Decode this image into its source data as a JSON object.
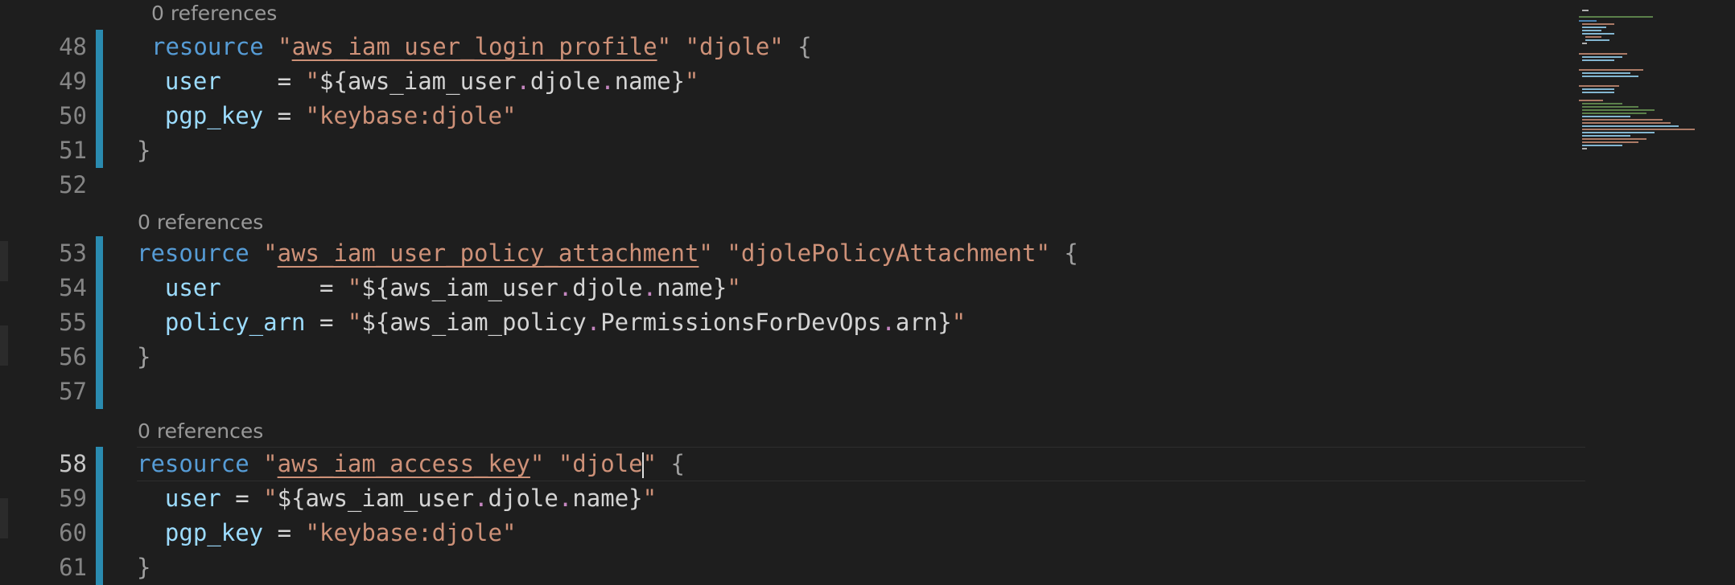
{
  "codelens": [
    "0 references",
    "0 references",
    "0 references"
  ],
  "lines": [
    {
      "number": "48",
      "tokens": [
        {
          "t": "resource",
          "c": "kw"
        },
        {
          "t": " ",
          "c": "punc"
        },
        {
          "t": "\"",
          "c": "str"
        },
        {
          "t": "aws_iam_user_login_profile",
          "c": "str ul"
        },
        {
          "t": "\"",
          "c": "str"
        },
        {
          "t": " ",
          "c": "punc"
        },
        {
          "t": "\"djole\"",
          "c": "str"
        },
        {
          "t": " {",
          "c": "brace"
        }
      ]
    },
    {
      "number": "49",
      "tokens": [
        {
          "t": "  ",
          "c": "punc"
        },
        {
          "t": "user",
          "c": "attr"
        },
        {
          "t": "    = ",
          "c": "punc"
        },
        {
          "t": "\"",
          "c": "str"
        },
        {
          "t": "${aws_iam_user",
          "c": "punc"
        },
        {
          "t": ".",
          "c": "dot"
        },
        {
          "t": "djole",
          "c": "punc"
        },
        {
          "t": ".",
          "c": "dot"
        },
        {
          "t": "name}",
          "c": "punc"
        },
        {
          "t": "\"",
          "c": "str"
        }
      ]
    },
    {
      "number": "50",
      "tokens": [
        {
          "t": "  ",
          "c": "punc"
        },
        {
          "t": "pgp_key",
          "c": "attr"
        },
        {
          "t": " = ",
          "c": "punc"
        },
        {
          "t": "\"keybase:djole\"",
          "c": "str"
        }
      ]
    },
    {
      "number": "51",
      "tokens": [
        {
          "t": "}",
          "c": "brace"
        }
      ]
    },
    {
      "number": "52",
      "tokens": []
    },
    {
      "number": "53",
      "tokens": [
        {
          "t": "resource",
          "c": "kw"
        },
        {
          "t": " ",
          "c": "punc"
        },
        {
          "t": "\"",
          "c": "str"
        },
        {
          "t": "aws_iam_user_policy_attachment",
          "c": "str ul"
        },
        {
          "t": "\"",
          "c": "str"
        },
        {
          "t": " ",
          "c": "punc"
        },
        {
          "t": "\"djolePolicyAttachment\"",
          "c": "str"
        },
        {
          "t": " {",
          "c": "brace"
        }
      ]
    },
    {
      "number": "54",
      "tokens": [
        {
          "t": "  ",
          "c": "punc"
        },
        {
          "t": "user",
          "c": "attr"
        },
        {
          "t": "       = ",
          "c": "punc"
        },
        {
          "t": "\"",
          "c": "str"
        },
        {
          "t": "${aws_iam_user",
          "c": "punc"
        },
        {
          "t": ".",
          "c": "dot"
        },
        {
          "t": "djole",
          "c": "punc"
        },
        {
          "t": ".",
          "c": "dot"
        },
        {
          "t": "name}",
          "c": "punc"
        },
        {
          "t": "\"",
          "c": "str"
        }
      ]
    },
    {
      "number": "55",
      "tokens": [
        {
          "t": "  ",
          "c": "punc"
        },
        {
          "t": "policy_arn",
          "c": "attr"
        },
        {
          "t": " = ",
          "c": "punc"
        },
        {
          "t": "\"",
          "c": "str"
        },
        {
          "t": "${aws_iam_policy",
          "c": "punc"
        },
        {
          "t": ".",
          "c": "dot"
        },
        {
          "t": "PermissionsForDevOps",
          "c": "punc"
        },
        {
          "t": ".",
          "c": "dot"
        },
        {
          "t": "arn}",
          "c": "punc"
        },
        {
          "t": "\"",
          "c": "str"
        }
      ]
    },
    {
      "number": "56",
      "tokens": [
        {
          "t": "}",
          "c": "brace"
        }
      ]
    },
    {
      "number": "57",
      "tokens": []
    },
    {
      "number": "58",
      "tokens": [
        {
          "t": "resource",
          "c": "kw"
        },
        {
          "t": " ",
          "c": "punc"
        },
        {
          "t": "\"",
          "c": "str"
        },
        {
          "t": "aws_iam_access_key",
          "c": "str ul"
        },
        {
          "t": "\"",
          "c": "str"
        },
        {
          "t": " ",
          "c": "punc"
        },
        {
          "t": "\"djole",
          "c": "str"
        },
        {
          "t": "|",
          "c": "cursor"
        },
        {
          "t": "\"",
          "c": "str"
        },
        {
          "t": " {",
          "c": "brace"
        }
      ]
    },
    {
      "number": "59",
      "tokens": [
        {
          "t": "  ",
          "c": "punc"
        },
        {
          "t": "user",
          "c": "attr"
        },
        {
          "t": " = ",
          "c": "punc"
        },
        {
          "t": "\"",
          "c": "str"
        },
        {
          "t": "${aws_iam_user",
          "c": "punc"
        },
        {
          "t": ".",
          "c": "dot"
        },
        {
          "t": "djole",
          "c": "punc"
        },
        {
          "t": ".",
          "c": "dot"
        },
        {
          "t": "name}",
          "c": "punc"
        },
        {
          "t": "\"",
          "c": "str"
        }
      ]
    },
    {
      "number": "60",
      "tokens": [
        {
          "t": "  ",
          "c": "punc"
        },
        {
          "t": "pgp_key",
          "c": "attr"
        },
        {
          "t": " = ",
          "c": "punc"
        },
        {
          "t": "\"keybase:djole\"",
          "c": "str"
        }
      ]
    },
    {
      "number": "61",
      "tokens": [
        {
          "t": "}",
          "c": "brace"
        }
      ]
    }
  ],
  "colors": {
    "background": "#1e1e1e",
    "keyword": "#569cd6",
    "string": "#ce9178",
    "attribute": "#9cdcfe",
    "modified_bar": "#2a8bb0"
  }
}
